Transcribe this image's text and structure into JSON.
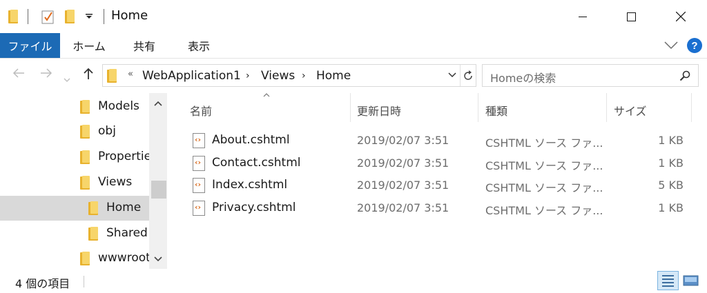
{
  "window": {
    "title": "Home"
  },
  "ribbon": {
    "tabs": [
      "ファイル",
      "ホーム",
      "共有",
      "表示"
    ]
  },
  "address": {
    "breadcrumb": [
      "WebApplication1",
      "Views",
      "Home"
    ],
    "search_placeholder": "Homeの検索"
  },
  "nav": {
    "items": [
      {
        "label": "Models"
      },
      {
        "label": "obj"
      },
      {
        "label": "Propertie"
      },
      {
        "label": "Views"
      },
      {
        "label": "Home",
        "selected": true
      },
      {
        "label": "Shared"
      },
      {
        "label": "wwwroot"
      }
    ]
  },
  "columns": {
    "name": "名前",
    "modified": "更新日時",
    "type": "種類",
    "size": "サイズ"
  },
  "files": [
    {
      "name": "About.cshtml",
      "modified": "2019/02/07 3:51",
      "type": "CSHTML ソース ファ...",
      "size": "1 KB"
    },
    {
      "name": "Contact.cshtml",
      "modified": "2019/02/07 3:51",
      "type": "CSHTML ソース ファ...",
      "size": "1 KB"
    },
    {
      "name": "Index.cshtml",
      "modified": "2019/02/07 3:51",
      "type": "CSHTML ソース ファ...",
      "size": "5 KB"
    },
    {
      "name": "Privacy.cshtml",
      "modified": "2019/02/07 3:51",
      "type": "CSHTML ソース ファ...",
      "size": "1 KB"
    }
  ],
  "status": {
    "item_count": "4 個の項目"
  },
  "colors": {
    "file_tab": "#1c6ab5",
    "help": "#1a6fd0",
    "folder": "#f7d56a"
  }
}
